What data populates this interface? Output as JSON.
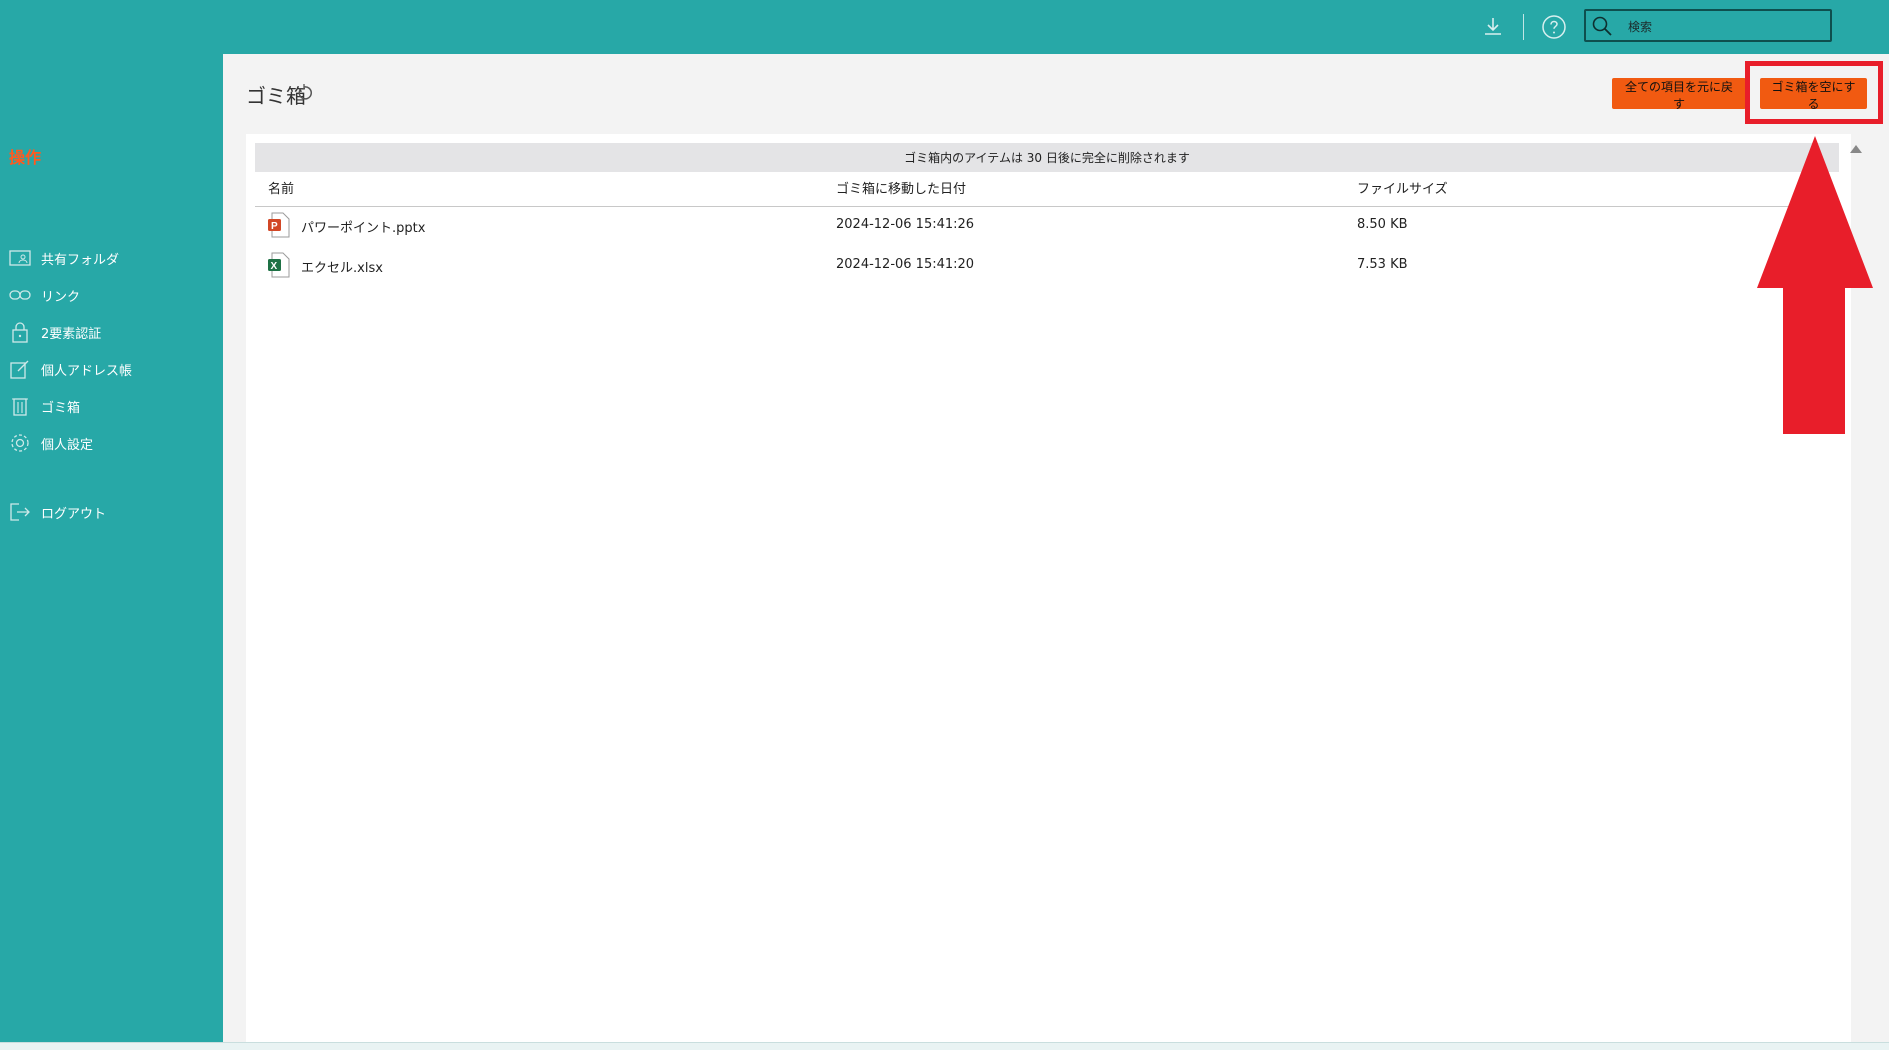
{
  "search": {
    "placeholder": "検索"
  },
  "sidebar": {
    "heading": "操作",
    "items": [
      {
        "label": "共有フォルダ",
        "icon": "shared-folder-icon"
      },
      {
        "label": "リンク",
        "icon": "link-icon"
      },
      {
        "label": "2要素認証",
        "icon": "lock-icon"
      },
      {
        "label": "個人アドレス帳",
        "icon": "edit-icon"
      },
      {
        "label": "ゴミ箱",
        "icon": "trash-icon"
      },
      {
        "label": "個人設定",
        "icon": "gear-icon"
      },
      {
        "label": "ログアウト",
        "icon": "logout-icon"
      }
    ]
  },
  "header": {
    "title": "ゴミ箱",
    "restore_all_label": "全ての項目を元に戻す",
    "empty_trash_label": "ゴミ箱を空にする"
  },
  "notice": "ゴミ箱内のアイテムは 30 日後に完全に削除されます",
  "table": {
    "columns": [
      "名前",
      "ゴミ箱に移動した日付",
      "ファイルサイズ"
    ],
    "rows": [
      {
        "name": "パワーポイント.pptx",
        "date": "2024-12-06 15:41:26",
        "size": "8.50 KB",
        "type": "pptx"
      },
      {
        "name": "エクセル.xlsx",
        "date": "2024-12-06 15:41:20",
        "size": "7.53 KB",
        "type": "xlsx"
      }
    ]
  },
  "colors": {
    "teal": "#27a8a7",
    "orange": "#f15a11",
    "annotation_red": "#e81e2a"
  }
}
